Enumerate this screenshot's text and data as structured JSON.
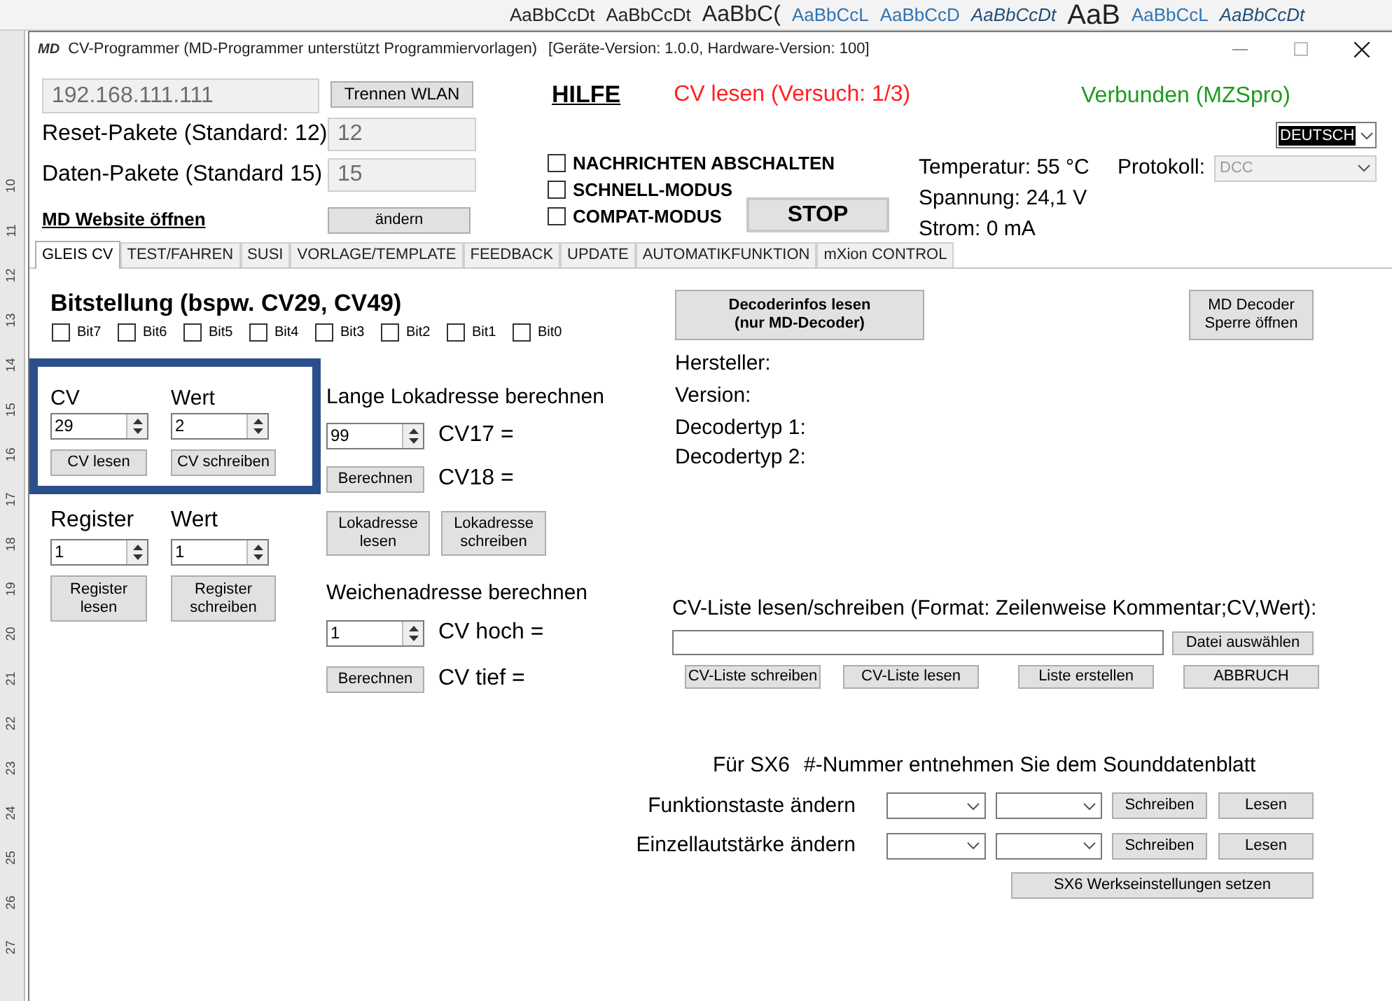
{
  "background_app": {
    "style_gallery": [
      {
        "text": "AaBbCcDt",
        "kind": "normal"
      },
      {
        "text": "AaBbCcDt",
        "kind": "normal"
      },
      {
        "text": "AaBbC(",
        "kind": "large"
      },
      {
        "text": "AaBbCcL",
        "kind": "heading"
      },
      {
        "text": "AaBbCcD",
        "kind": "heading"
      },
      {
        "text": "AaBbCcDt",
        "kind": "emphasis"
      },
      {
        "text": "AaB",
        "kind": "title"
      },
      {
        "text": "AaBbCcL",
        "kind": "heading"
      },
      {
        "text": "AaBbCcDt",
        "kind": "emphasis"
      }
    ],
    "ruler_marks": [
      "10",
      "11",
      "12",
      "13",
      "14",
      "15",
      "16",
      "17",
      "18",
      "19",
      "20",
      "21",
      "22",
      "23",
      "24",
      "25",
      "26",
      "27"
    ]
  },
  "window": {
    "logo": "MD",
    "title": "CV-Programmer (MD-Programmer unterstützt Programmiervorlagen)",
    "version_info": "[Geräte-Version: 1.0.0, Hardware-Version: 100]"
  },
  "connection": {
    "ip_address": "192.168.111.111",
    "disconnect_button": "Trennen WLAN",
    "help_link": "HILFE",
    "cv_status": "CV lesen (Versuch: 1/3)",
    "connection_status": "Verbunden (MZSpro)"
  },
  "packets": [
    {
      "label": "Reset-Pakete (Standard: 12)",
      "value": "12"
    },
    {
      "label": "Daten-Pakete (Standard 15)",
      "value": "15"
    }
  ],
  "website_link": "MD Website öffnen",
  "change_button": "ändern",
  "options": [
    {
      "label": "NACHRICHTEN ABSCHALTEN",
      "checked": false
    },
    {
      "label": "SCHNELL-MODUS",
      "checked": false
    },
    {
      "label": "COMPAT-MODUS",
      "checked": false
    }
  ],
  "stop_button": "STOP",
  "readings": [
    "Temperatur: 55 °C",
    "Spannung: 24,1 V",
    "Strom: 0 mA"
  ],
  "language": "DEUTSCH",
  "protocol": {
    "label": "Protokoll:",
    "value": "DCC",
    "disabled": true
  },
  "tabs": [
    {
      "label": "GLEIS CV",
      "selected": true
    },
    {
      "label": "TEST/FAHREN",
      "selected": false
    },
    {
      "label": "SUSI",
      "selected": false
    },
    {
      "label": "VORLAGE/TEMPLATE",
      "selected": false
    },
    {
      "label": "FEEDBACK",
      "selected": false
    },
    {
      "label": "UPDATE",
      "selected": false
    },
    {
      "label": "AUTOMATIKFUNKTION",
      "selected": false
    },
    {
      "label": "mXion CONTROL",
      "selected": false
    }
  ],
  "bits": {
    "title": "Bitstellung (bspw. CV29, CV49)",
    "items": [
      {
        "label": "Bit7",
        "checked": false
      },
      {
        "label": "Bit6",
        "checked": false
      },
      {
        "label": "Bit5",
        "checked": false
      },
      {
        "label": "Bit4",
        "checked": false
      },
      {
        "label": "Bit3",
        "checked": false
      },
      {
        "label": "Bit2",
        "checked": false
      },
      {
        "label": "Bit1",
        "checked": false
      },
      {
        "label": "Bit0",
        "checked": false
      }
    ]
  },
  "cv": {
    "highlighted": true,
    "columns": [
      {
        "label": "CV",
        "value": "29",
        "button": "CV lesen"
      },
      {
        "label": "Wert",
        "value": "2",
        "button": "CV schreiben"
      }
    ]
  },
  "register": {
    "columns": [
      {
        "label": "Register",
        "value": "1",
        "button": [
          "Register",
          "lesen"
        ]
      },
      {
        "label": "Wert",
        "value": "1",
        "button": [
          "Register",
          "schreiben"
        ]
      }
    ]
  },
  "loco_address": {
    "title": "Lange Lokadresse berechnen",
    "value": "99",
    "results": [
      "CV17 =",
      "CV18 ="
    ],
    "calc_button": "Berechnen",
    "read_button": [
      "Lokadresse",
      "lesen"
    ],
    "write_button": [
      "Lokadresse",
      "schreiben"
    ]
  },
  "turnout_address": {
    "title": "Weichenadresse berechnen",
    "value": "1",
    "results": [
      "CV hoch =",
      "CV tief ="
    ],
    "calc_button": "Berechnen"
  },
  "decoder_info": {
    "read_button": [
      "Decoderinfos lesen",
      "(nur MD-Decoder)"
    ],
    "unlock_button": [
      "MD Decoder",
      "Sperre öffnen"
    ],
    "fields": [
      "Hersteller:",
      "Version:",
      "Decodertyp 1:",
      "Decodertyp 2:"
    ]
  },
  "cv_list": {
    "title": "CV-Liste lesen/schreiben (Format: Zeilenweise Kommentar;CV,Wert):",
    "file_button": "Datei auswählen",
    "buttons": [
      "CV-Liste schreiben",
      "CV-Liste lesen",
      "Liste erstellen",
      "ABBRUCH"
    ]
  },
  "sx6": {
    "title": "Für SX6",
    "note": "#-Nummer entnehmen Sie dem Sounddatenblatt",
    "rows": [
      {
        "label": "Funktionstaste ändern",
        "write_button": "Schreiben",
        "read_button": "Lesen"
      },
      {
        "label": "Einzellautstärke ändern",
        "write_button": "Schreiben",
        "read_button": "Lesen"
      }
    ],
    "factory_button": "SX6 Werkseinstellungen setzen"
  }
}
